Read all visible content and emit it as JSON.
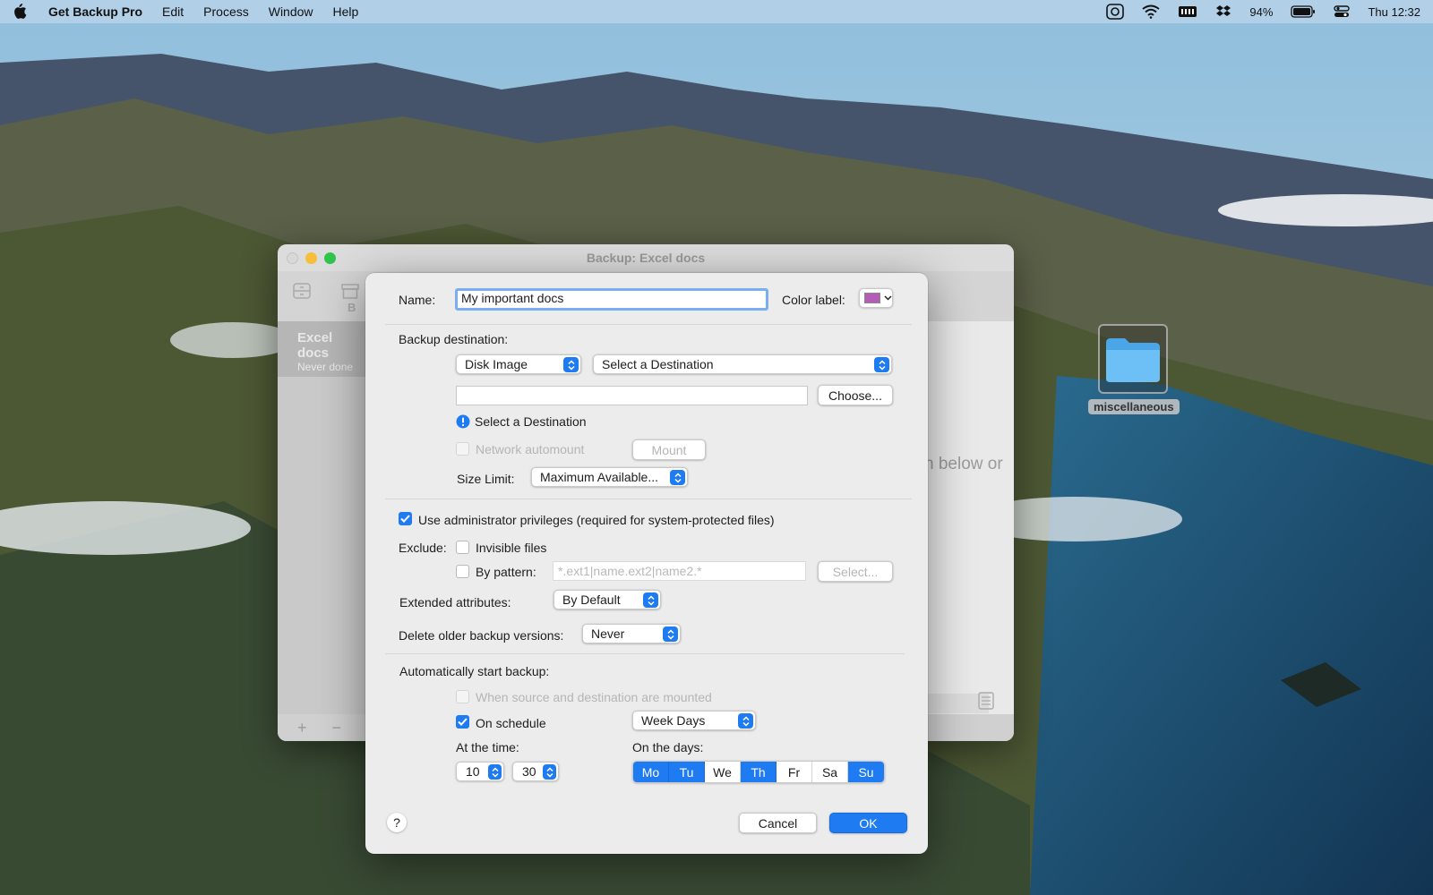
{
  "menubar": {
    "app_name": "Get Backup Pro",
    "menus": [
      "Edit",
      "Process",
      "Window",
      "Help"
    ],
    "battery": "94%",
    "clock": "Thu 12:32"
  },
  "desktop": {
    "folder_label": "miscellaneous"
  },
  "back_window": {
    "title": "Backup: Excel docs",
    "sidebar_item_title": "Excel docs",
    "sidebar_item_subtitle": "Never done",
    "toolbar_partial_label": "B",
    "hint_text": "n below or"
  },
  "dialog": {
    "name_label": "Name:",
    "name_value": "My important docs",
    "color_label": "Color label:",
    "color_value": "#b35eb6",
    "backup_destination_label": "Backup destination:",
    "destination_type": "Disk Image",
    "destination_select": "Select a Destination",
    "path_value": "",
    "choose_button": "Choose...",
    "warning_text": "Select a Destination",
    "network_automount_label": "Network automount",
    "mount_button": "Mount",
    "size_limit_label": "Size Limit:",
    "size_limit_value": "Maximum Available...",
    "admin_privileges_label": "Use administrator privileges (required for system-protected files)",
    "admin_privileges_checked": true,
    "exclude_label": "Exclude:",
    "invisible_files_label": "Invisible files",
    "by_pattern_label": "By pattern:",
    "pattern_placeholder": "*.ext1|name.ext2|name2.*",
    "select_button": "Select...",
    "extended_attributes_label": "Extended attributes:",
    "extended_attributes_value": "By Default",
    "delete_older_label": "Delete older backup versions:",
    "delete_older_value": "Never",
    "auto_start_label": "Automatically start backup:",
    "when_mounted_label": "When source and destination are mounted",
    "on_schedule_label": "On schedule",
    "on_schedule_checked": true,
    "schedule_type": "Week Days",
    "at_time_label": "At the time:",
    "hour": "10",
    "minute": "30",
    "on_days_label": "On the days:",
    "days": [
      {
        "label": "Mo",
        "on": true
      },
      {
        "label": "Tu",
        "on": true
      },
      {
        "label": "We",
        "on": false
      },
      {
        "label": "Th",
        "on": true
      },
      {
        "label": "Fr",
        "on": false
      },
      {
        "label": "Sa",
        "on": false
      },
      {
        "label": "Su",
        "on": true
      }
    ],
    "help_button": "?",
    "cancel_button": "Cancel",
    "ok_button": "OK"
  }
}
